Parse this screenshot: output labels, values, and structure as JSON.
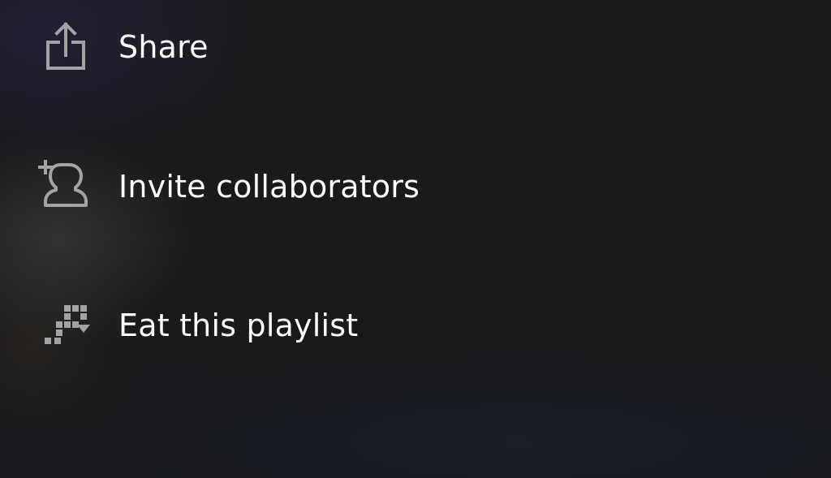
{
  "menu": {
    "items": [
      {
        "label": "Share",
        "icon": "share-icon"
      },
      {
        "label": "Invite collaborators",
        "icon": "add-user-icon"
      },
      {
        "label": "Eat this playlist",
        "icon": "pixel-playlist-icon"
      }
    ]
  },
  "colors": {
    "background": "#1a1a1b",
    "text": "#ffffff",
    "icon": "#a3a3a3"
  }
}
